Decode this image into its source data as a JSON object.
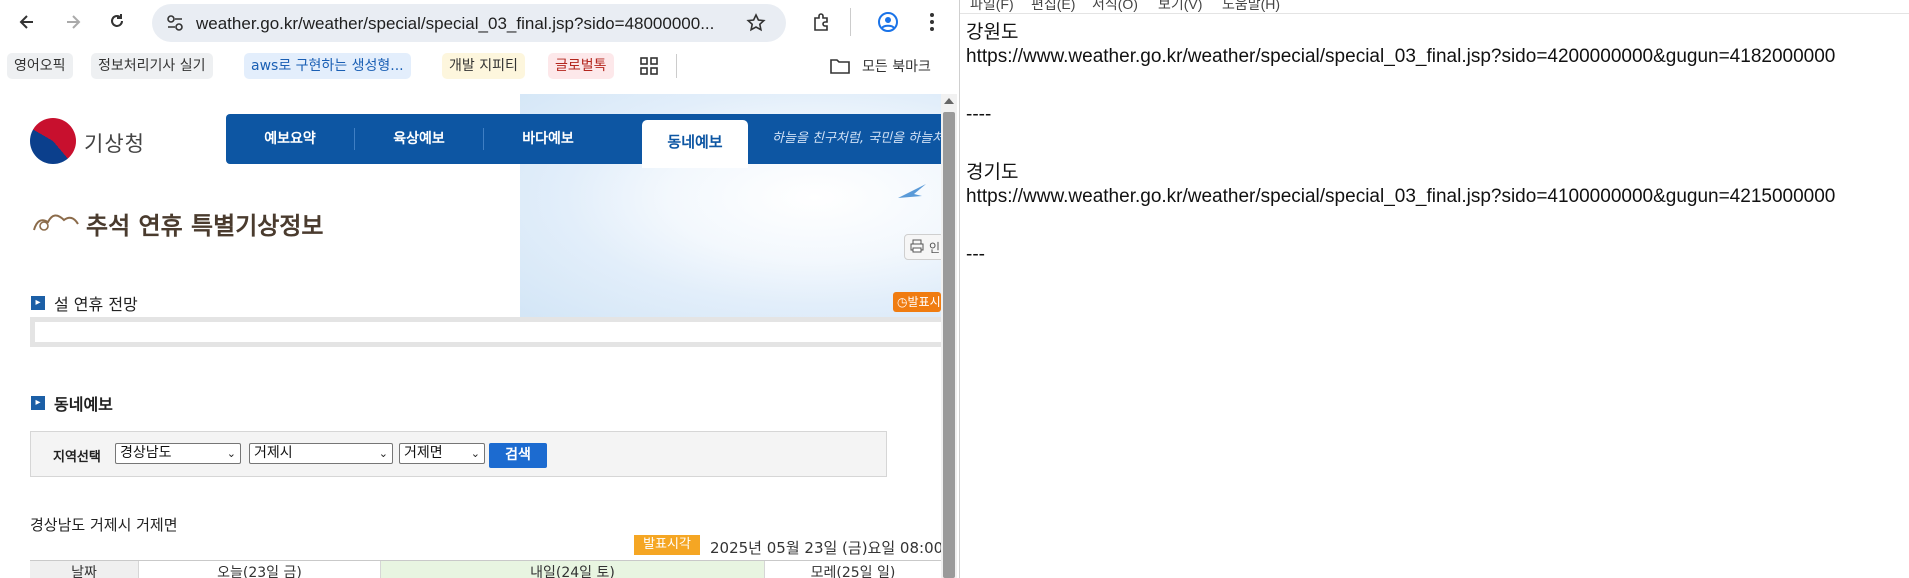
{
  "browser": {
    "url": "weather.go.kr/weather/special/special_03_final.jsp?sido=48000000...",
    "bookmarks": [
      {
        "label": "영어오픽",
        "color": "#eef0f2"
      },
      {
        "label": "정보처리기사 실기",
        "color": "#eef0f2"
      },
      {
        "label": "aws로 구현하는 생성형...",
        "color": "#e3eefc"
      },
      {
        "label": "개발 지피티",
        "color": "#fdf6dd"
      },
      {
        "label": "글로벌톡",
        "color": "#fde8ea"
      }
    ],
    "all_bookmarks_label": "모든 북마크"
  },
  "page": {
    "logo_text": "기상청",
    "nav": [
      "예보요약",
      "육상예보",
      "바다예보"
    ],
    "nav_active": "동네예보",
    "slogan": "하늘을 친구처럼, 국민을 하늘처럼",
    "title": "추석 연휴 특별기상정보",
    "print_label": "인",
    "section1": "설 연휴 전망",
    "release_badge": "발표시",
    "section2": "동네예보",
    "search": {
      "label": "지역선택",
      "sido": "경상남도",
      "gugun": "거제시",
      "dong": "거제면",
      "button": "검색"
    },
    "location": "경상남도 거제시 거제면",
    "release_label": "발표시각",
    "release_time": "2025년 05월 23일 (금)요일 08:00",
    "table_headers": [
      "날짜",
      "오늘(23일 금)",
      "내일(24일 토)",
      "모레(25일 일)"
    ]
  },
  "notepad": {
    "menus": [
      "파일(F)",
      "편집(E)",
      "서식(O)",
      "보기(V)",
      "도움말(H)"
    ],
    "lines": [
      "강원도",
      "https://www.weather.go.kr/weather/special/special_03_final.jsp?sido=4200000000&gugun=4182000000",
      "",
      "----",
      "",
      "경기도",
      "https://www.weather.go.kr/weather/special/special_03_final.jsp?sido=4100000000&gugun=4215000000",
      "",
      "---"
    ]
  },
  "colors": {
    "gnb": "#0d56a3",
    "search_button": "#1c6bd0",
    "badge_orange": "#f5a623"
  }
}
